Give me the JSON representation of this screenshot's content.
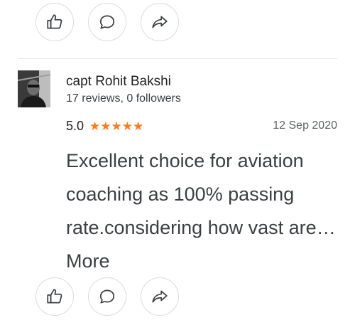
{
  "top_actions": [
    {
      "icon": "thumbs-up-icon"
    },
    {
      "icon": "comment-icon"
    },
    {
      "icon": "share-icon"
    }
  ],
  "review": {
    "reviewer_name": "capt Rohit Bakshi",
    "reviewer_meta": "17 reviews, 0 followers",
    "rating": "5.0",
    "stars": "★★★★★",
    "date": "12 Sep 2020",
    "text": "Excellent choice for aviation coaching as 100% passing rate.considering how vast are…",
    "more_label": "More"
  },
  "bottom_actions": [
    {
      "icon": "thumbs-up-icon"
    },
    {
      "icon": "comment-icon"
    },
    {
      "icon": "share-icon"
    }
  ],
  "colors": {
    "star": "#ff7a1a",
    "text": "#3c4043",
    "border": "#dadce0"
  }
}
